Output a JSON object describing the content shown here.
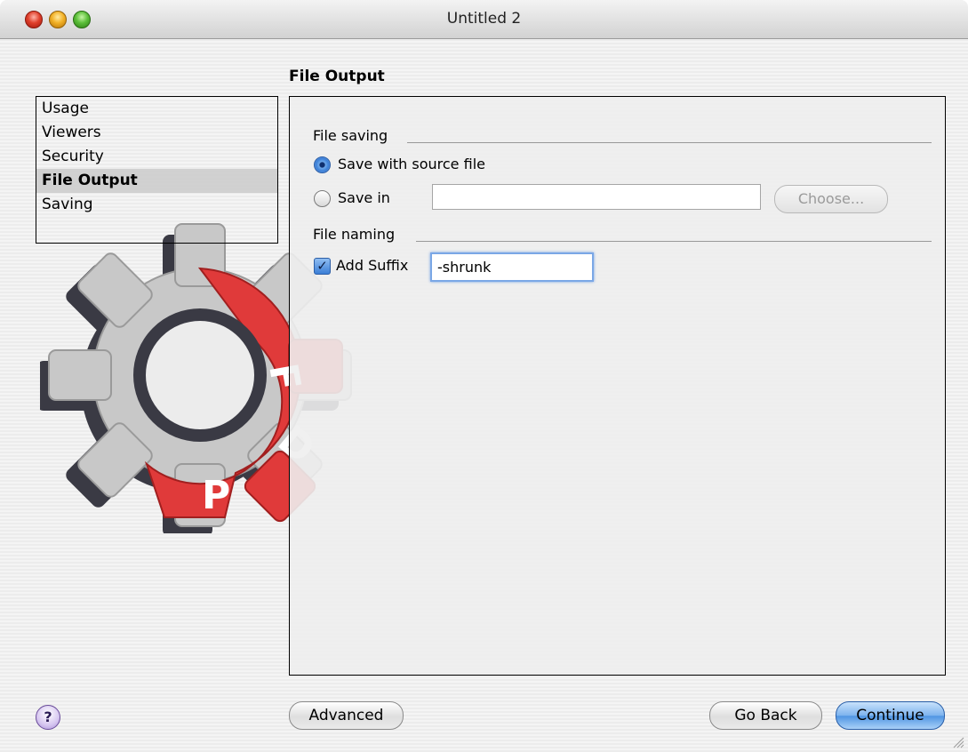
{
  "window": {
    "title": "Untitled 2"
  },
  "section_heading": "File Output",
  "sidebar": {
    "items": [
      {
        "label": "Usage",
        "selected": false
      },
      {
        "label": "Viewers",
        "selected": false
      },
      {
        "label": "Security",
        "selected": false
      },
      {
        "label": "File Output",
        "selected": true
      },
      {
        "label": "Saving",
        "selected": false
      }
    ]
  },
  "panel": {
    "file_saving": {
      "group_label": "File saving",
      "option_source": "Save with source file",
      "option_save_in": "Save in",
      "save_in_path": "",
      "choose_label": "Choose...",
      "selected": "source"
    },
    "file_naming": {
      "group_label": "File naming",
      "suffix_label": "Add Suffix",
      "suffix_checked": true,
      "suffix_value": "-shrunk"
    }
  },
  "footer": {
    "help_label": "?",
    "advanced_label": "Advanced",
    "go_back_label": "Go Back",
    "continue_label": "Continue"
  },
  "logo": {
    "letters": "PDF",
    "colors": {
      "gear_gray": "#c8c8c8",
      "gear_red": "#e03a3a",
      "shadow": "#3a3a44"
    }
  },
  "icons": {
    "close": "red-traffic-light",
    "minimize": "yellow-traffic-light",
    "zoom": "green-traffic-light",
    "resize": "resize-grip-icon"
  }
}
